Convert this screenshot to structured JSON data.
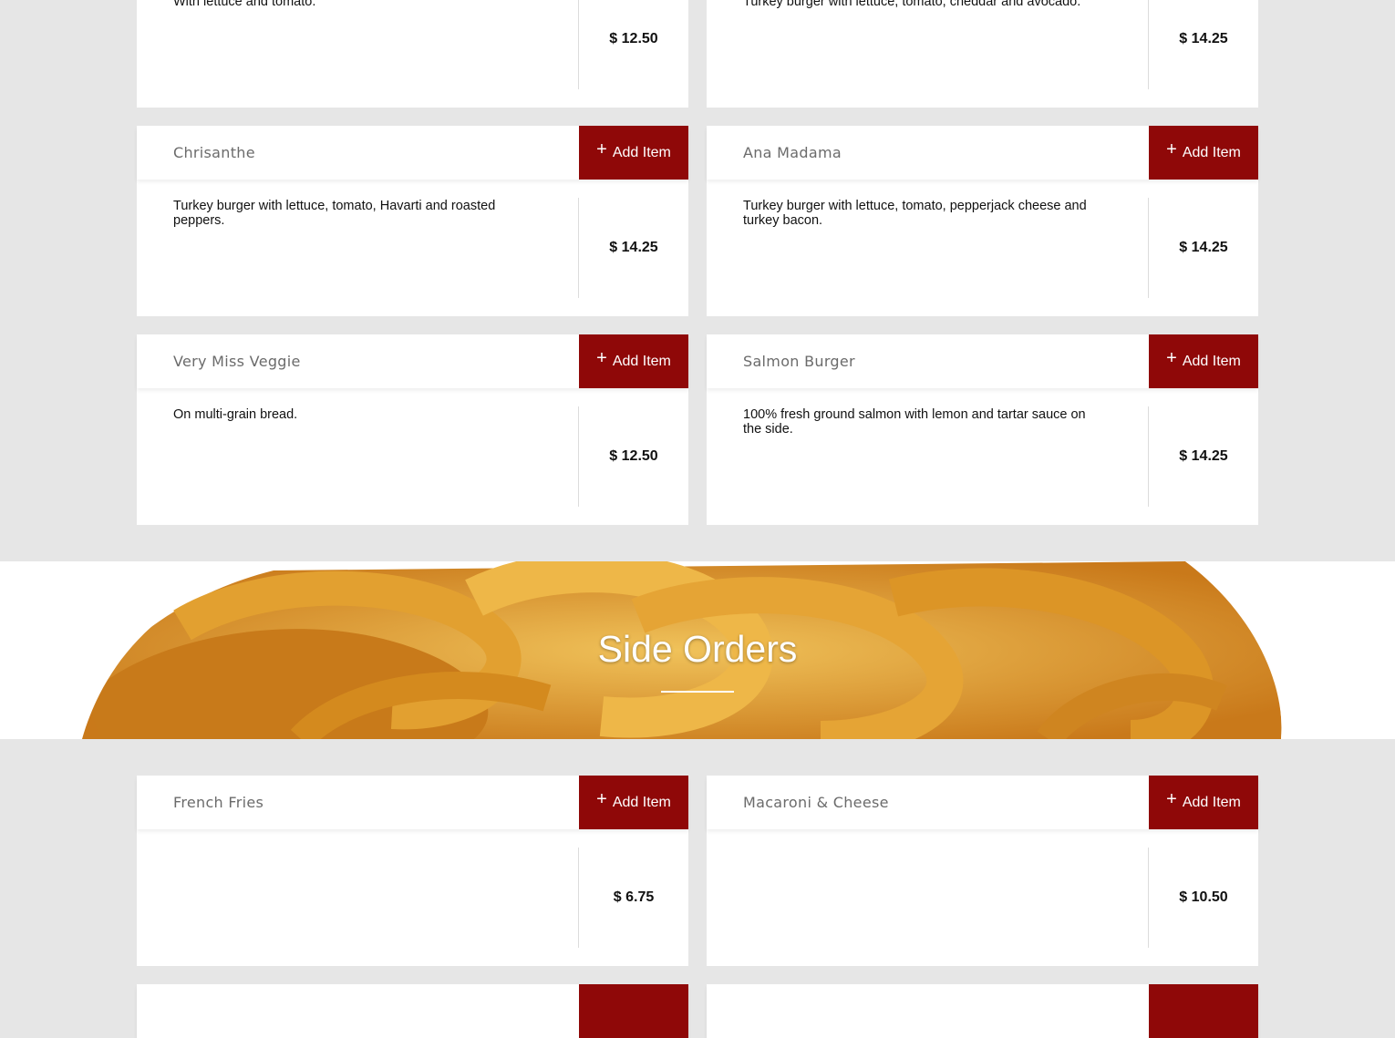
{
  "colors": {
    "accent": "#8f0808",
    "background": "#e6e6e6",
    "card": "#ffffff"
  },
  "icons": {
    "add": "plus-icon"
  },
  "add_label": "Add Item",
  "plus_glyph": "+",
  "top_partial": [
    {
      "description": "With lettuce and tomato.",
      "price": "$ 12.50"
    },
    {
      "description": "Turkey burger with lettuce, tomato, cheddar and avocado.",
      "price": "$ 14.25"
    }
  ],
  "burgers": [
    {
      "name": "Chrisanthe",
      "description": "Turkey burger with lettuce, tomato, Havarti and roasted peppers.",
      "price": "$ 14.25"
    },
    {
      "name": "Ana Madama",
      "description": "Turkey burger with lettuce, tomato, pepperjack cheese and turkey bacon.",
      "price": "$ 14.25"
    },
    {
      "name": "Very Miss Veggie",
      "description": "On multi-grain bread.",
      "price": "$ 12.50"
    },
    {
      "name": "Salmon Burger",
      "description": "100% fresh ground salmon with lemon and tartar sauce on the side.",
      "price": "$ 14.25"
    }
  ],
  "section": {
    "title": "Side Orders"
  },
  "sides": [
    {
      "name": "French Fries",
      "description": "",
      "price": "$ 6.75"
    },
    {
      "name": "Macaroni & Cheese",
      "description": "",
      "price": "$ 10.50"
    }
  ]
}
